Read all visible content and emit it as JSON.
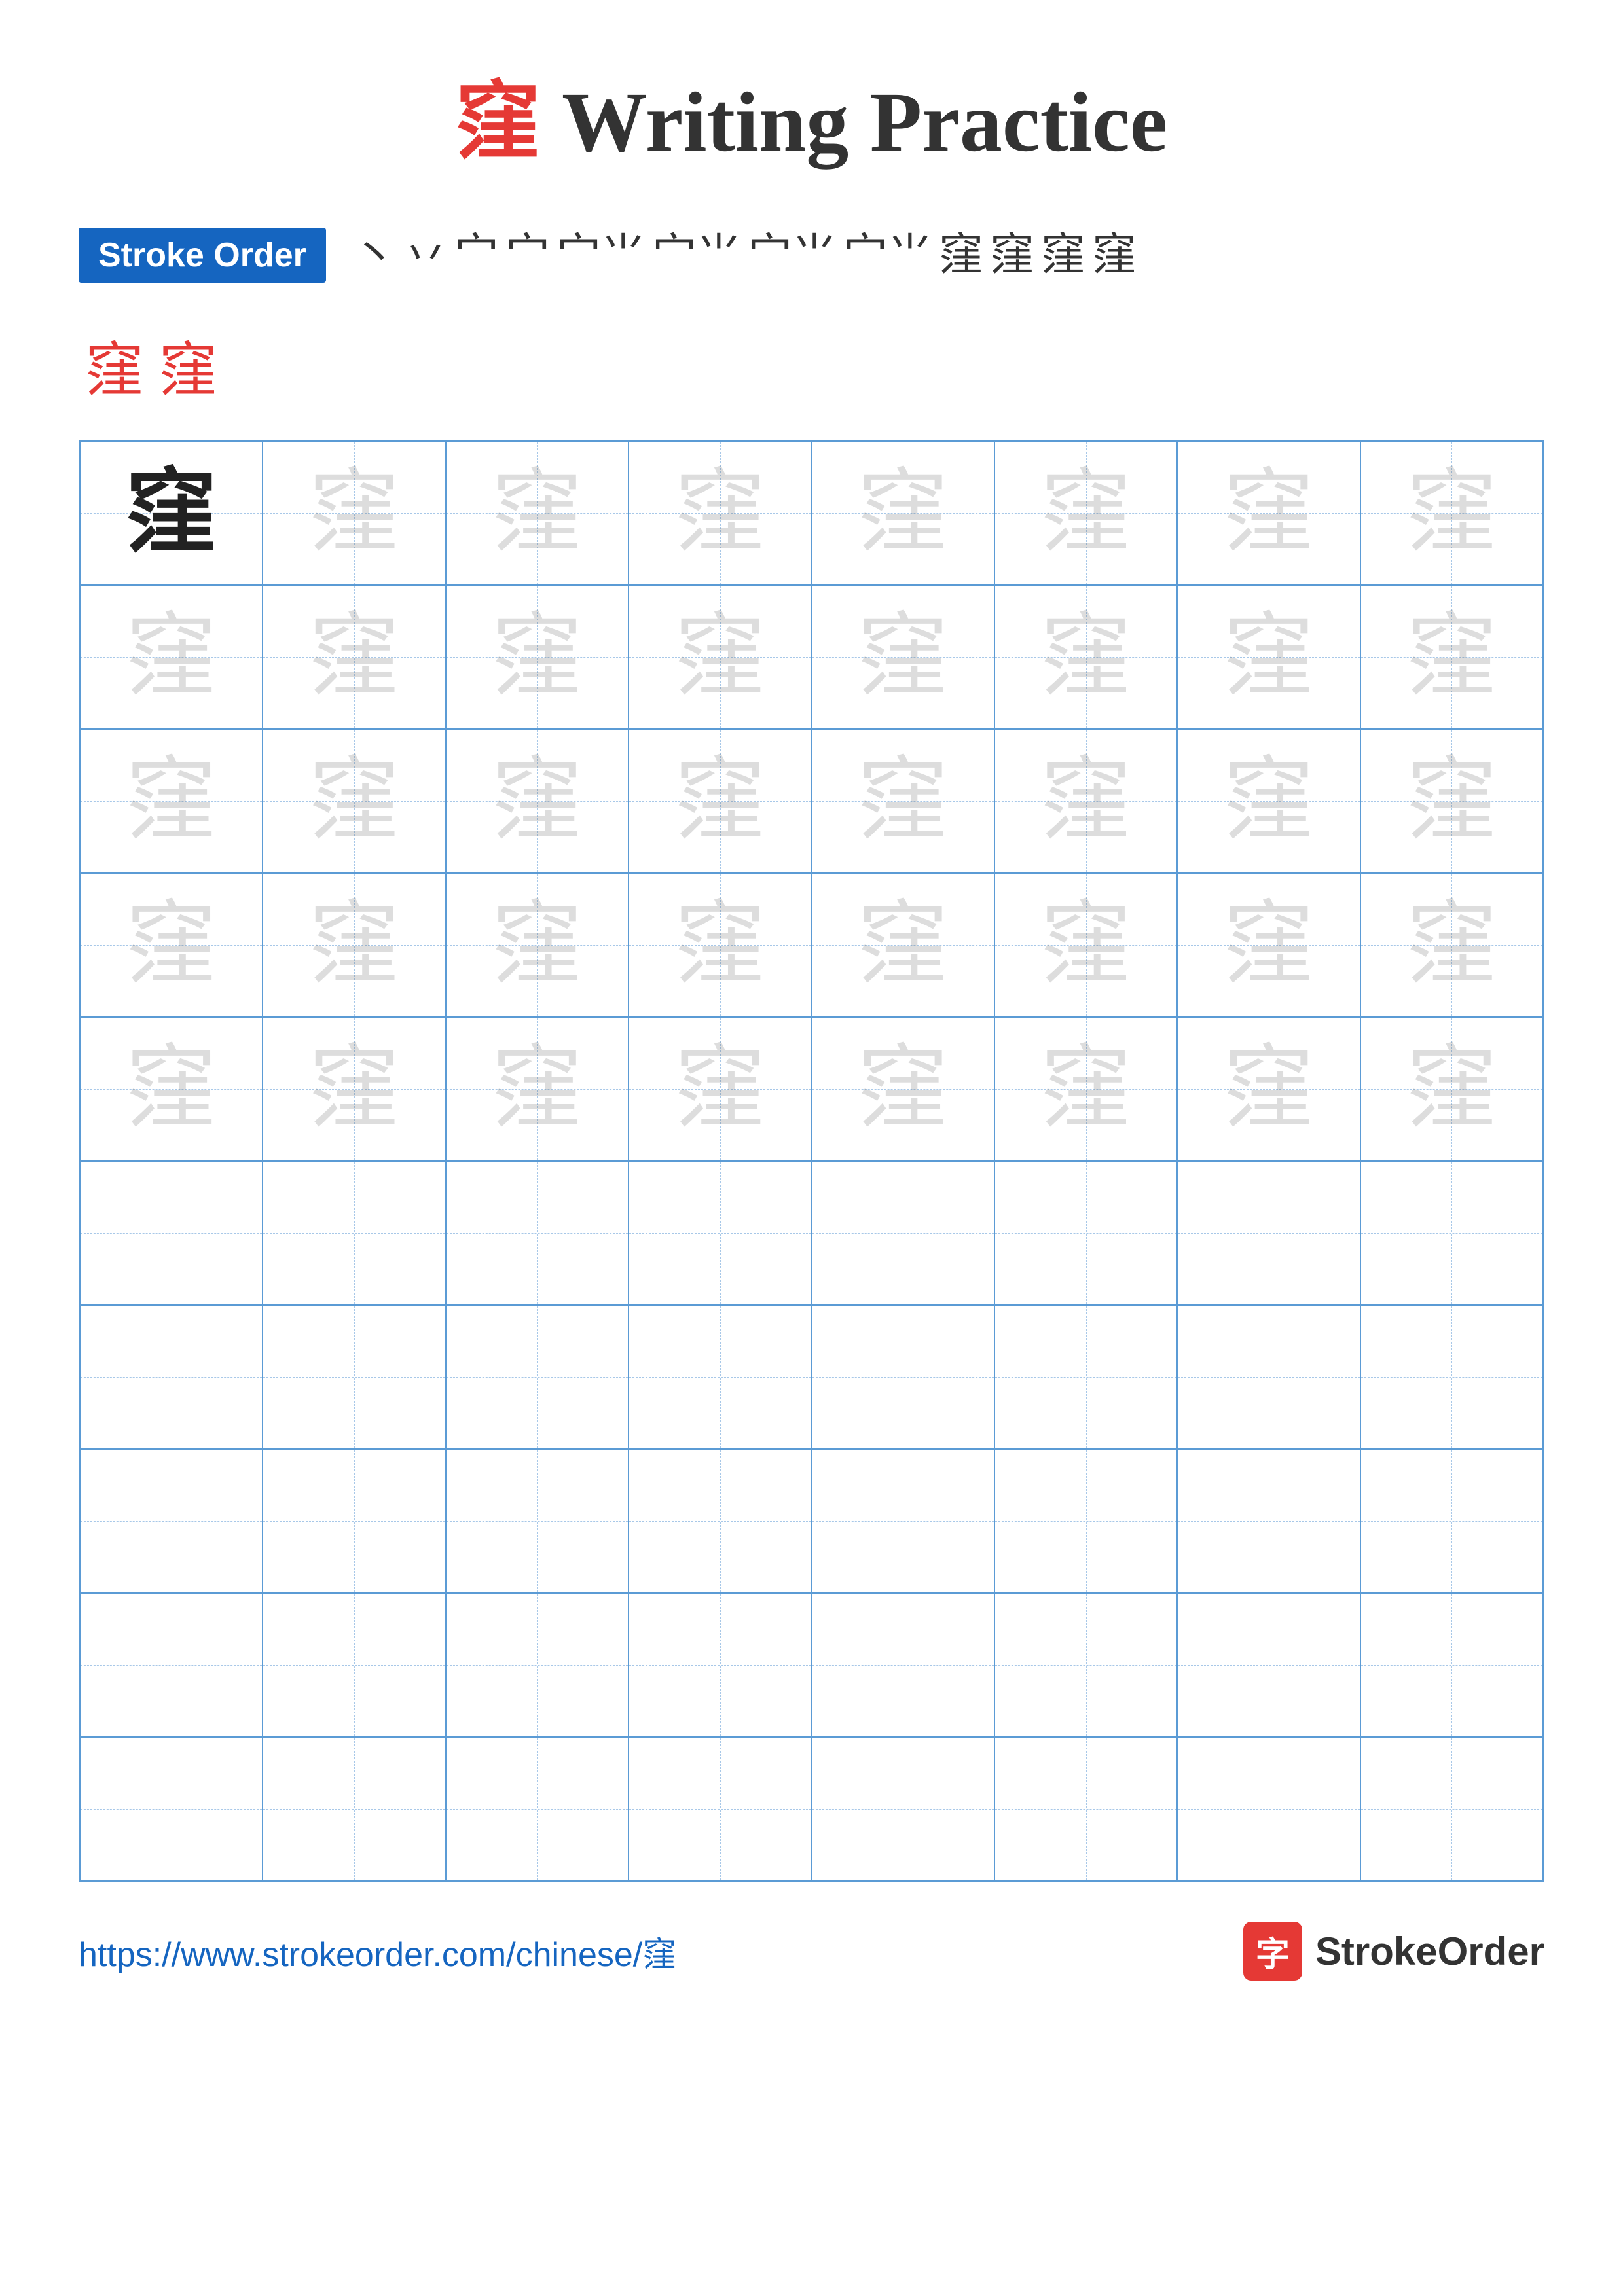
{
  "title": {
    "chinese": "窪",
    "english": " Writing Practice"
  },
  "stroke_order": {
    "badge_label": "Stroke Order",
    "sequence": [
      "丶",
      "丿",
      "宀",
      "宀",
      "宀⺌",
      "宀⺌⺌",
      "宀⺌⺌⺌",
      "宀⺌⺌⺌⺌",
      "宀⺌窪",
      "宀⺌窪",
      "窪",
      "窪"
    ],
    "extra_chars": "窪 窪"
  },
  "grid": {
    "rows": 10,
    "cols": 8,
    "practice_char": "窪",
    "filled_rows": 5
  },
  "footer": {
    "url": "https://www.strokeorder.com/chinese/窪",
    "brand": "StrokeOrder",
    "logo_char": "字"
  }
}
